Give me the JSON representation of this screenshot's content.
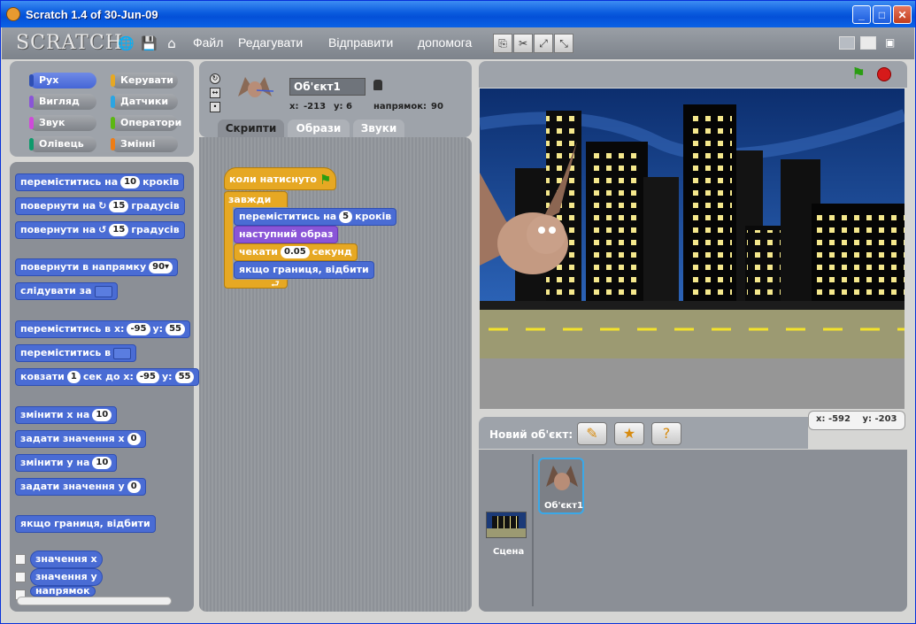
{
  "window": {
    "title": "Scratch 1.4 of 30-Jun-09",
    "minimize": "_",
    "maximize": "□",
    "close": "✕"
  },
  "menu": {
    "logo": "SCRATCH",
    "items": [
      "Файл",
      "Редагувати",
      "Відправити",
      "допомога"
    ]
  },
  "categories": [
    {
      "label": "Рух",
      "color": "#4a6cd4"
    },
    {
      "label": "Керувати",
      "color": "#e6a823"
    },
    {
      "label": "Вигляд",
      "color": "#8a55d7"
    },
    {
      "label": "Датчики",
      "color": "#2ca5e2"
    },
    {
      "label": "Звук",
      "color": "#cf4ad9"
    },
    {
      "label": "Оператори",
      "color": "#5cb712"
    },
    {
      "label": "Олівець",
      "color": "#0e9a6c"
    },
    {
      "label": "Змінні",
      "color": "#ee7d16"
    }
  ],
  "palette": {
    "move": {
      "a": "переміститись на",
      "n": "10",
      "b": "кроків"
    },
    "turn_cw": {
      "a": "повернути на",
      "n": "15",
      "b": "градусів"
    },
    "turn_ccw": {
      "a": "повернути на",
      "n": "15",
      "b": "градусів"
    },
    "point_dir": {
      "a": "повернути в напрямку",
      "n": "90▾"
    },
    "follow": {
      "a": "слідувати за"
    },
    "goto_xy": {
      "a": "переміститись в x:",
      "x": "-95",
      "b": "y:",
      "y": "55"
    },
    "goto": {
      "a": "переміститись в"
    },
    "glide": {
      "a": "ковзати",
      "n": "1",
      "b": "сек до x:",
      "x": "-95",
      "c": "y:",
      "y": "55"
    },
    "change_x": {
      "a": "змінити х на",
      "n": "10"
    },
    "set_x": {
      "a": "задати значення х",
      "n": "0"
    },
    "change_y": {
      "a": "змінити у на",
      "n": "10"
    },
    "set_y": {
      "a": "задати значення у",
      "n": "0"
    },
    "bounce": "якщо границя, відбити",
    "rep_x": "значення х",
    "rep_y": "значення у",
    "rep_dir": "напрямок"
  },
  "sprite": {
    "name": "Об'єкт1",
    "x_label": "x:",
    "x": "-213",
    "y_label": "y:",
    "y": "6",
    "dir_label": "напрямок:",
    "dir": "90"
  },
  "tabs": [
    "Скрипти",
    "Образи",
    "Звуки"
  ],
  "script": {
    "hat": "коли натиснуто",
    "forever": "завжди",
    "move": {
      "a": "переміститись на",
      "n": "5",
      "b": "кроків"
    },
    "next_costume": "наступний образ",
    "wait": {
      "a": "чекати",
      "n": "0.05",
      "b": "секунд"
    },
    "bounce": "якщо границя, відбити"
  },
  "stage_coords": {
    "x_label": "x:",
    "x": "-592",
    "y_label": "y:",
    "y": "-203"
  },
  "new_sprite_label": "Новий об'єкт:",
  "sprites": [
    {
      "label": "Сцена"
    },
    {
      "label": "Об'єкт1"
    }
  ]
}
